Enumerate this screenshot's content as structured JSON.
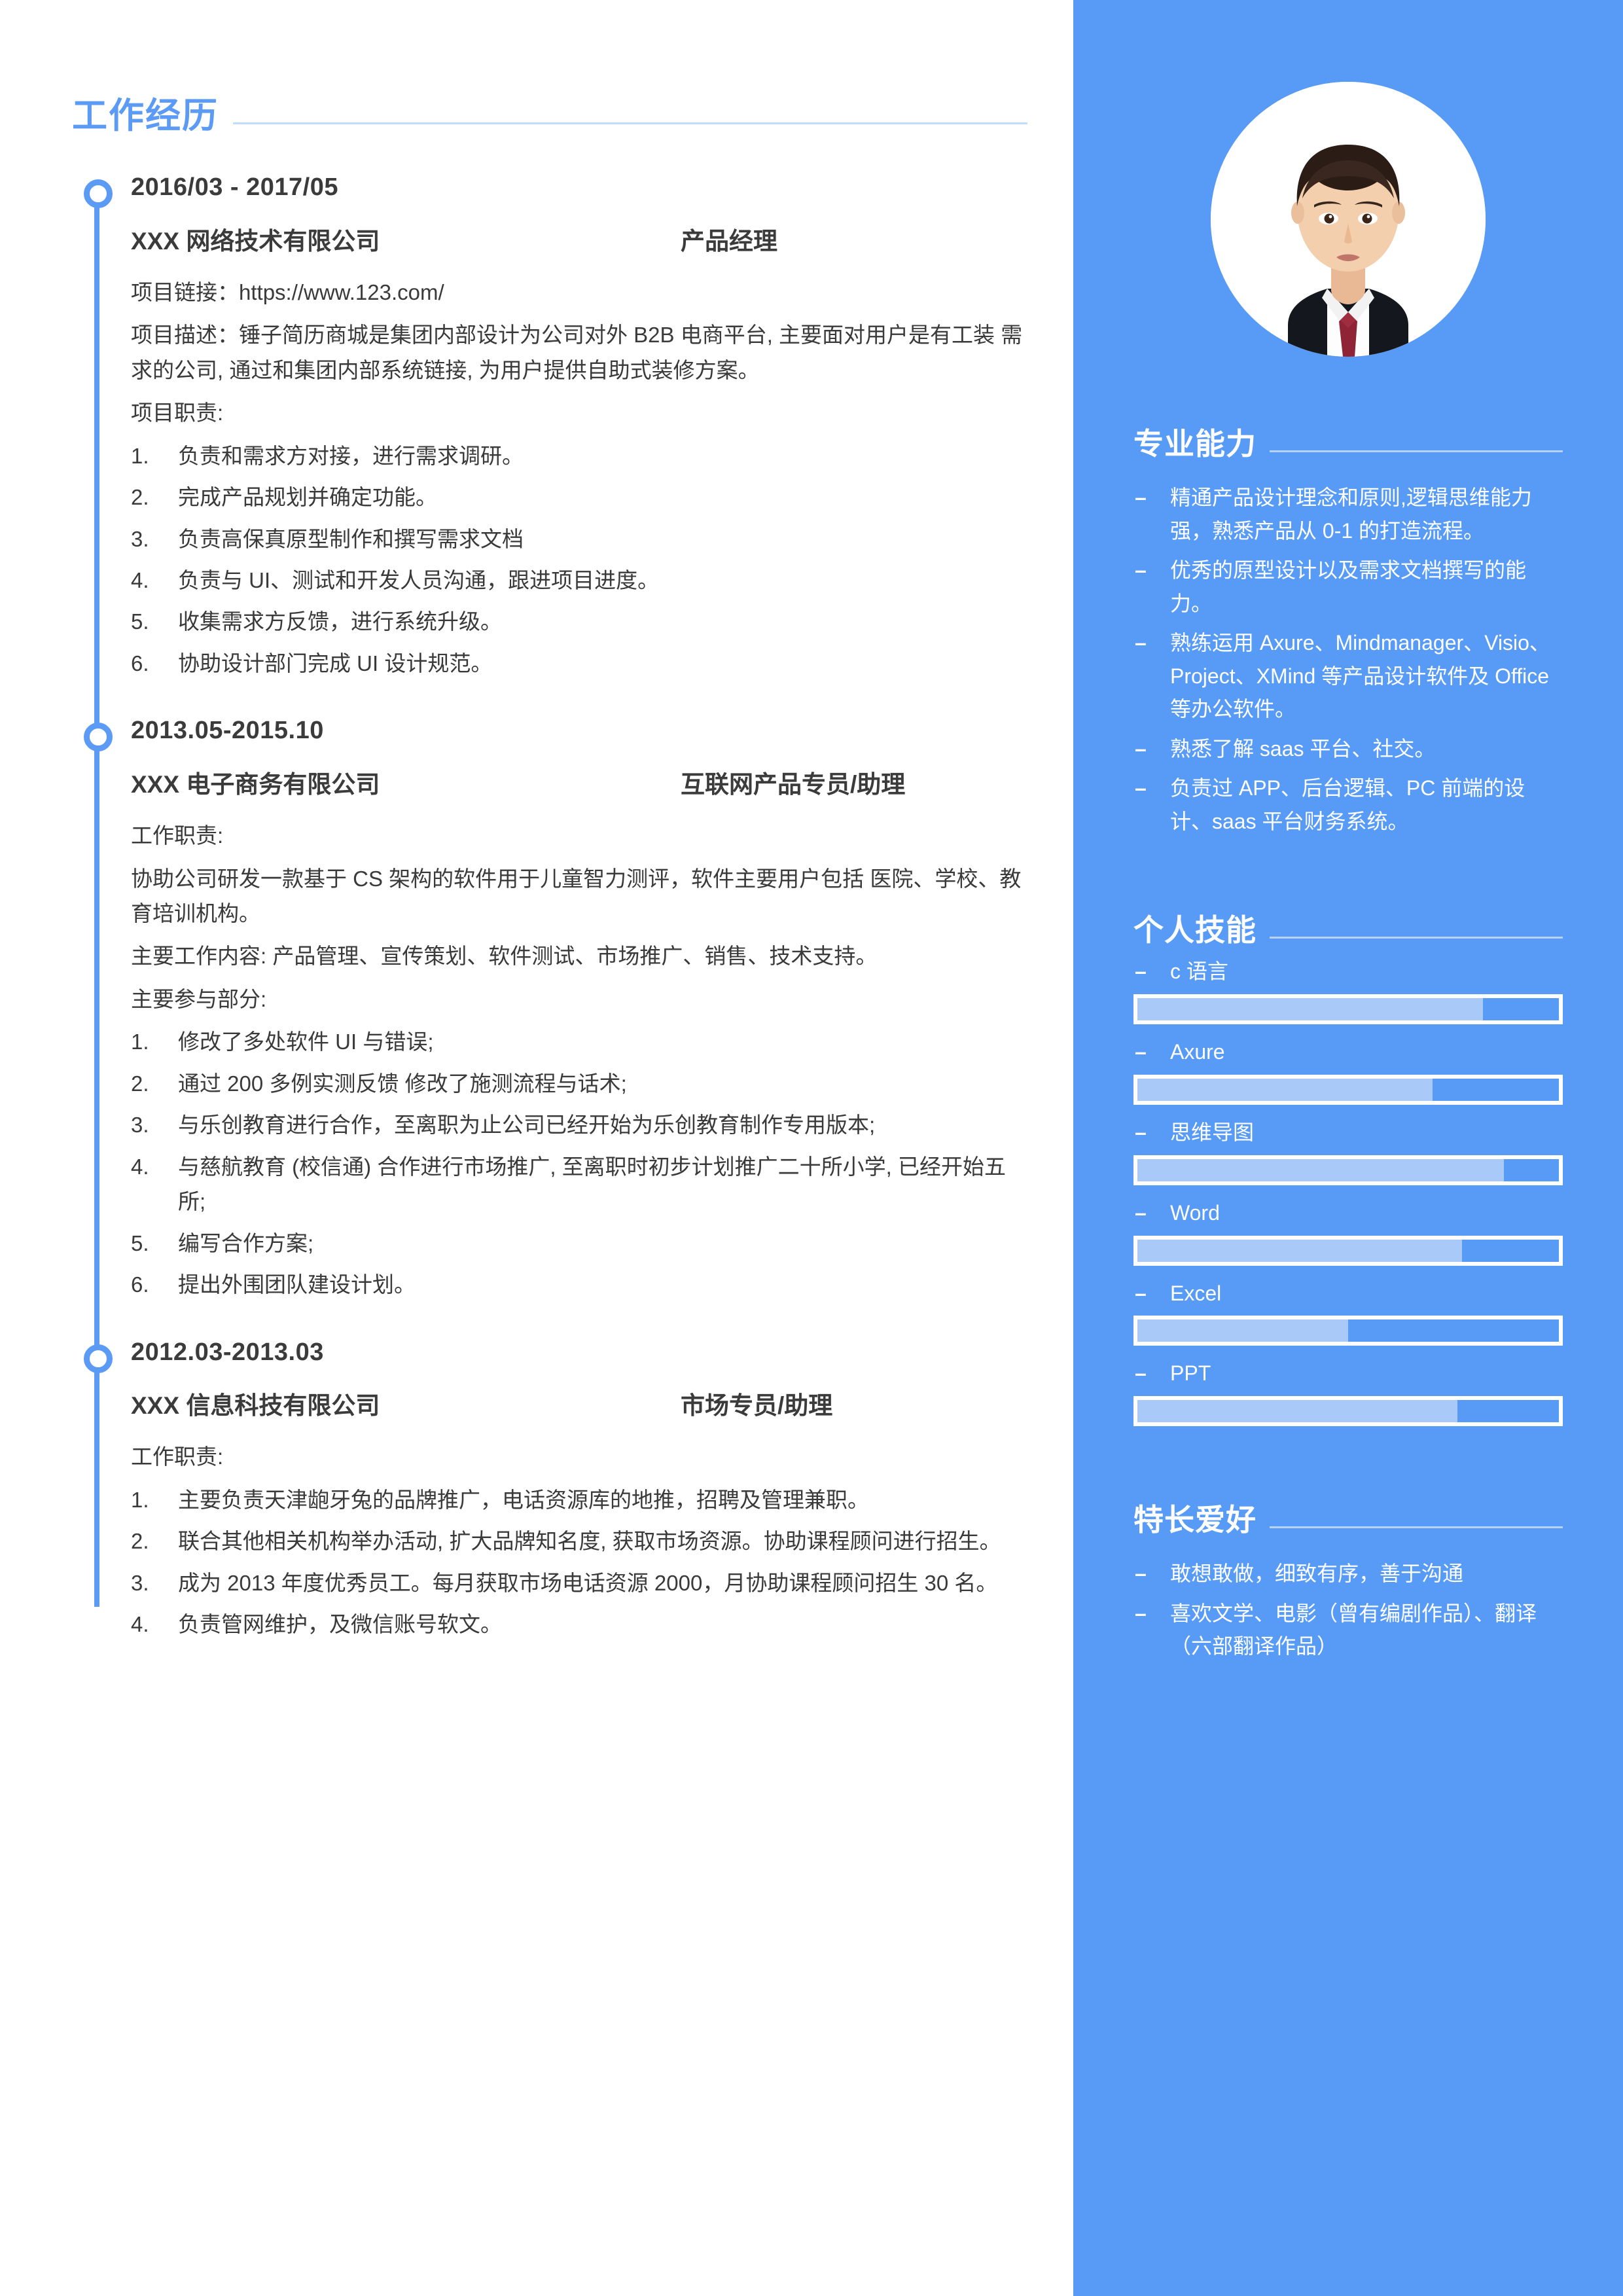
{
  "theme": {
    "accent_blue": "#5b9bf5",
    "sidebar_blue": "#579bf7",
    "skill_fill": "#a9caf9",
    "text_dark": "#3a3a3a"
  },
  "left": {
    "section_title": "工作经历",
    "jobs": [
      {
        "date": "2016/03 - 2017/05",
        "company": "XXX 网络技术有限公司",
        "position": "产品经理",
        "lines": [
          "项目链接：https://www.123.com/",
          "项目描述：锤子简历商城是集团内部设计为公司对外 B2B 电商平台, 主要面对用户是有工装 需求的公司, 通过和集团内部系统链接, 为用户提供自助式装修方案。",
          "项目职责:"
        ],
        "items": [
          {
            "num": "1.",
            "text": "负责和需求方对接，进行需求调研。"
          },
          {
            "num": "2.",
            "text": "完成产品规划并确定功能。"
          },
          {
            "num": "3.",
            "text": "负责高保真原型制作和撰写需求文档"
          },
          {
            "num": "4.",
            "text": "负责与 UI、测试和开发人员沟通，跟进项目进度。"
          },
          {
            "num": "5.",
            "text": "收集需求方反馈，进行系统升级。"
          },
          {
            "num": "6.",
            "text": "协助设计部门完成 UI 设计规范。"
          }
        ]
      },
      {
        "date": "2013.05-2015.10",
        "company": "XXX 电子商务有限公司",
        "position": "互联网产品专员/助理",
        "lines": [
          "工作职责:",
          "协助公司研发一款基于 CS 架构的软件用于儿童智力测评，软件主要用户包括 医院、学校、教育培训机构。",
          "主要工作内容: 产品管理、宣传策划、软件测试、市场推广、销售、技术支持。",
          "主要参与部分:"
        ],
        "items": [
          {
            "num": "1.",
            "text": "修改了多处软件 UI 与错误;"
          },
          {
            "num": "2.",
            "text": "通过 200 多例实测反馈 修改了施测流程与话术;"
          },
          {
            "num": "3.",
            "text": "与乐创教育进行合作，至离职为止公司已经开始为乐创教育制作专用版本;"
          },
          {
            "num": "4.",
            "text": "与慈航教育 (校信通) 合作进行市场推广, 至离职时初步计划推广二十所小学, 已经开始五所;"
          },
          {
            "num": "5.",
            "text": "编写合作方案;"
          },
          {
            "num": "6.",
            "text": "提出外围团队建设计划。"
          }
        ]
      },
      {
        "date": "2012.03-2013.03",
        "company": "XXX 信息科技有限公司",
        "position": "市场专员/助理",
        "lines": [
          "工作职责:"
        ],
        "items": [
          {
            "num": "1.",
            "text": "主要负责天津龅牙兔的品牌推广，电话资源库的地推，招聘及管理兼职。"
          },
          {
            "num": "2.",
            "text": "联合其他相关机构举办活动, 扩大品牌知名度, 获取市场资源。协助课程顾问进行招生。"
          },
          {
            "num": "3.",
            "text": "成为 2013 年度优秀员工。每月获取市场电话资源 2000，月协助课程顾问招生 30 名。"
          },
          {
            "num": "4.",
            "text": "负责管网维护，及微信账号软文。"
          }
        ]
      }
    ]
  },
  "right": {
    "photo_alt": "profile-photo",
    "professional": {
      "title": "专业能力",
      "items": [
        "精通产品设计理念和原则,逻辑思维能力强，熟悉产品从 0-1 的打造流程。",
        "优秀的原型设计以及需求文档撰写的能力。",
        "熟练运用 Axure、Mindmanager、Visio、Project、XMind 等产品设计软件及 Office 等办公软件。",
        "熟悉了解 saas 平台、社交。",
        "负责过 APP、后台逻辑、PC 前端的设计、saas 平台财务系统。"
      ]
    },
    "skills": {
      "title": "个人技能",
      "items": [
        {
          "label": "c 语言",
          "percent": 82
        },
        {
          "label": "Axure",
          "percent": 70
        },
        {
          "label": "思维导图",
          "percent": 87
        },
        {
          "label": "Word",
          "percent": 77
        },
        {
          "label": "Excel",
          "percent": 50
        },
        {
          "label": "PPT",
          "percent": 76
        }
      ]
    },
    "hobbies": {
      "title": "特长爱好",
      "items": [
        "敢想敢做，细致有序，善于沟通",
        "喜欢文学、电影（曾有编剧作品）、翻译（六部翻译作品）"
      ]
    }
  }
}
